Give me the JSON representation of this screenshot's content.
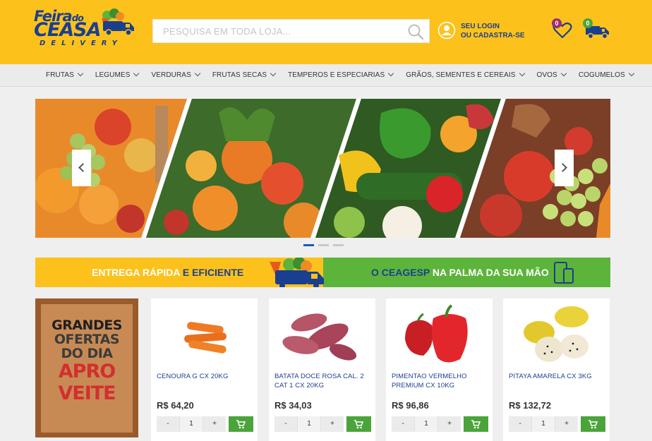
{
  "brand": {
    "line1": "Feira",
    "line1_small": "do",
    "line2": "CEASA",
    "line3": "DELIVERY"
  },
  "colors": {
    "header_bg": "#fcc21b",
    "brand_blue": "#1b3f8f",
    "add_green": "#4aa43a",
    "fav_badge": "#9b2f6f",
    "cart_badge": "#4aa43a"
  },
  "search": {
    "placeholder": "PESQUISA EM TODA LOJA...",
    "icon": "search-icon"
  },
  "account": {
    "line1": "SEU LOGIN",
    "line2": "OU CADASTRA-SE",
    "icon": "user-icon"
  },
  "favorites": {
    "count": "0",
    "icon": "heart-icon"
  },
  "cart": {
    "count": "0",
    "icon": "delivery-truck-icon"
  },
  "nav": {
    "items": [
      {
        "label": "FRUTAS"
      },
      {
        "label": "LEGUMES"
      },
      {
        "label": "VERDURAS"
      },
      {
        "label": "FRUTAS SECAS"
      },
      {
        "label": "TEMPEROS E ESPECIARIAS"
      },
      {
        "label": "GRÃOS, SEMENTES E CEREAIS"
      },
      {
        "label": "OVOS"
      },
      {
        "label": "COGUMELOS"
      }
    ]
  },
  "carousel": {
    "slides": 3,
    "active": 1
  },
  "promo": {
    "left_a": "ENTREGA RÁPIDA",
    "left_b": "E EFICIENTE",
    "right_a": "O CEAGESP",
    "right_b": "NA PALMA DA SUA MÃO"
  },
  "offers": {
    "line1": "GRANDES",
    "line2": "OFERTAS",
    "line3": "DO DIA",
    "line4": "APRO",
    "line5": "VEITE"
  },
  "products": [
    {
      "name": "CENOURA G CX 20KG",
      "price": "R$ 64,20",
      "qty": "1",
      "minus": "-",
      "plus": "+"
    },
    {
      "name": "BATATA DOCE ROSA CAL. 2 CAT 1 CX 20KG",
      "price": "R$ 34,03",
      "qty": "1",
      "minus": "-",
      "plus": "+"
    },
    {
      "name": "PIMENTAO VERMELHO PREMIUM CX 10KG",
      "price": "R$ 96,86",
      "qty": "1",
      "minus": "-",
      "plus": "+"
    },
    {
      "name": "PITAYA AMARELA CX 3KG",
      "price": "R$ 132,72",
      "qty": "1",
      "minus": "-",
      "plus": "+"
    }
  ]
}
